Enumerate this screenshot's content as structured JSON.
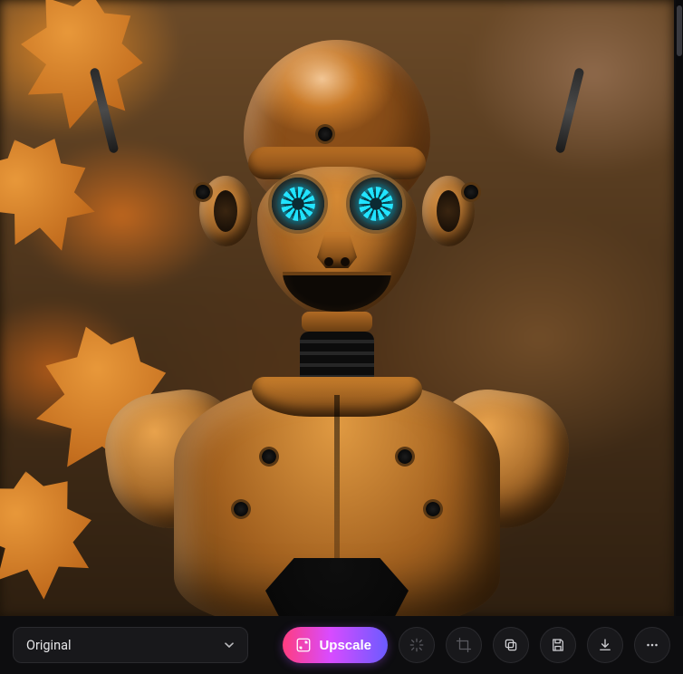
{
  "image": {
    "description": "orange-humanoid-robot-autumn-leaves",
    "eye_glow_color": "#1de3ff",
    "body_color": "#c97a28"
  },
  "toolbar": {
    "size_select": {
      "selected": "Original"
    },
    "upscale_label": "Upscale",
    "icons": {
      "variations": "variations-icon",
      "crop": "crop-icon",
      "copy": "copy-icon",
      "save": "save-icon",
      "download": "download-icon",
      "more": "more-icon"
    }
  },
  "colors": {
    "accent_gradient_start": "#ff3d7f",
    "accent_gradient_mid": "#d94bff",
    "accent_gradient_end": "#6b5bff",
    "surface": "#18181b",
    "background": "#0d0d0f"
  }
}
